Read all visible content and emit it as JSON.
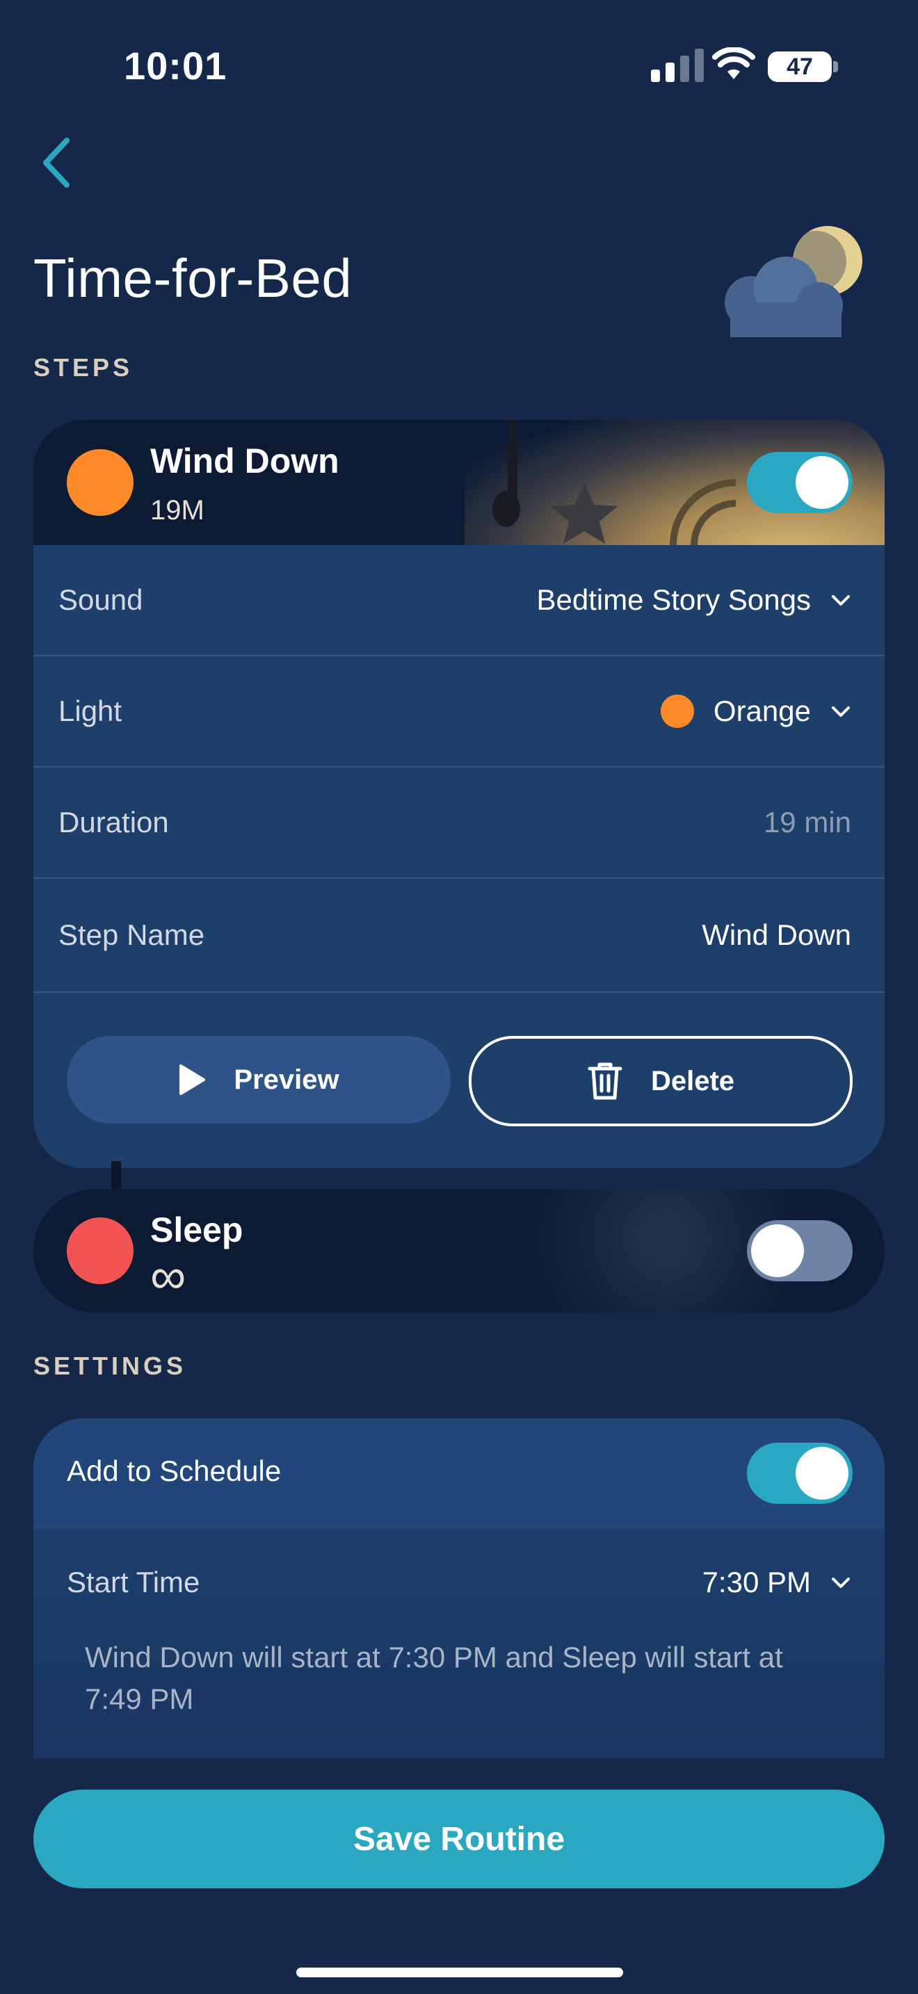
{
  "status_bar": {
    "time": "10:01",
    "battery": "47"
  },
  "header": {
    "title": "Time-for-Bed"
  },
  "steps_section": {
    "label": "STEPS"
  },
  "wind_down": {
    "name": "Wind Down",
    "duration_short": "19M",
    "color": "#ff8a2a",
    "enabled": true,
    "rows": {
      "sound_label": "Sound",
      "sound_value": "Bedtime Story Songs",
      "light_label": "Light",
      "light_value": "Orange",
      "duration_label": "Duration",
      "duration_value": "19 min",
      "name_label": "Step Name",
      "name_value": "Wind Down"
    },
    "preview_label": "Preview",
    "delete_label": "Delete"
  },
  "sleep": {
    "name": "Sleep",
    "duration_symbol": "∞",
    "color": "#f25353",
    "enabled": false
  },
  "settings_section": {
    "label": "SETTINGS",
    "schedule_label": "Add to Schedule",
    "schedule_enabled": true,
    "start_time_label": "Start Time",
    "start_time_value": "7:30 PM",
    "note": "Wind Down will start at 7:30 PM and Sleep will start at 7:49 PM"
  },
  "save_label": "Save Routine",
  "colors": {
    "accent": "#2aa8c2",
    "background": "#16284a",
    "orange": "#ff8a2a",
    "red": "#f25353"
  }
}
